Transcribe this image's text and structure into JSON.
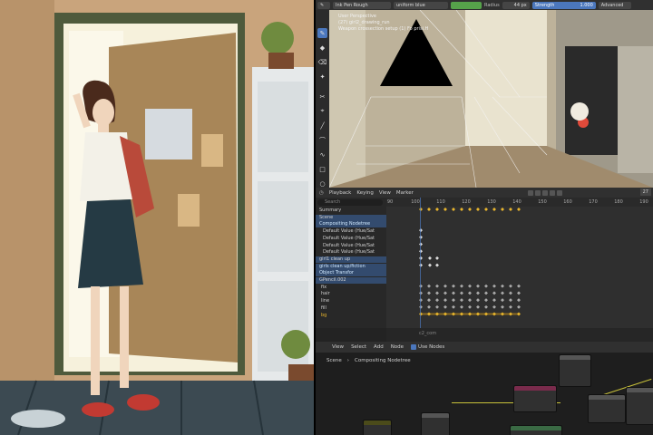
{
  "viewport_header": {
    "brush_name": "Ink Pen Rough",
    "material": "uniform blue",
    "radius_label": "Radius",
    "radius_value": "44 px",
    "strength_label": "Strength",
    "strength_value": "1.000",
    "advanced_label": "Advanced"
  },
  "viewport_overlay": {
    "line1": "User Perspective",
    "line2": "(27) girl2_drawing_run",
    "line3": "Weapon crossection setup (1) Fo prisi.H"
  },
  "timeline": {
    "playback_label": "Playback",
    "keying_label": "Keying",
    "view_label": "View",
    "marker_label": "Marker",
    "current_frame": "27",
    "ticks": [
      "90",
      "100",
      "110",
      "120",
      "130",
      "140",
      "150",
      "160",
      "170",
      "180",
      "190"
    ],
    "search_placeholder": "Search",
    "channels": [
      {
        "label": "Summary",
        "type": "summary"
      },
      {
        "label": "Scene",
        "type": "scene"
      },
      {
        "label": "Compositing Nodetree",
        "type": "group"
      },
      {
        "label": "Default Value (Hue/Sat",
        "type": "item"
      },
      {
        "label": "Default Value (Hue/Sat",
        "type": "item"
      },
      {
        "label": "Default Value (Hue/Sat",
        "type": "item"
      },
      {
        "label": "Default Value (Hue/Sat",
        "type": "item"
      },
      {
        "label": "girl1 clean up",
        "type": "object"
      },
      {
        "label": "girls clean up/fiction",
        "type": "group"
      },
      {
        "label": "Object Transfor",
        "type": "group"
      },
      {
        "label": "GPencil.002",
        "type": "gp"
      },
      {
        "label": "fix",
        "type": "layer"
      },
      {
        "label": "hair",
        "type": "layer"
      },
      {
        "label": "line",
        "type": "layer"
      },
      {
        "label": "fill",
        "type": "layer"
      },
      {
        "label": "bg",
        "type": "layer-active"
      }
    ],
    "watermark": "c2_com"
  },
  "node_editor": {
    "menu": [
      "View",
      "Select",
      "Add",
      "Node"
    ],
    "use_nodes_label": "Use Nodes",
    "breadcrumb_scene": "Scene",
    "breadcrumb_tree": "Compositing Nodetree"
  },
  "colors": {
    "accent": "#4b77bd",
    "keyframe": "#e9b62d",
    "wire": "#c9c23a"
  }
}
